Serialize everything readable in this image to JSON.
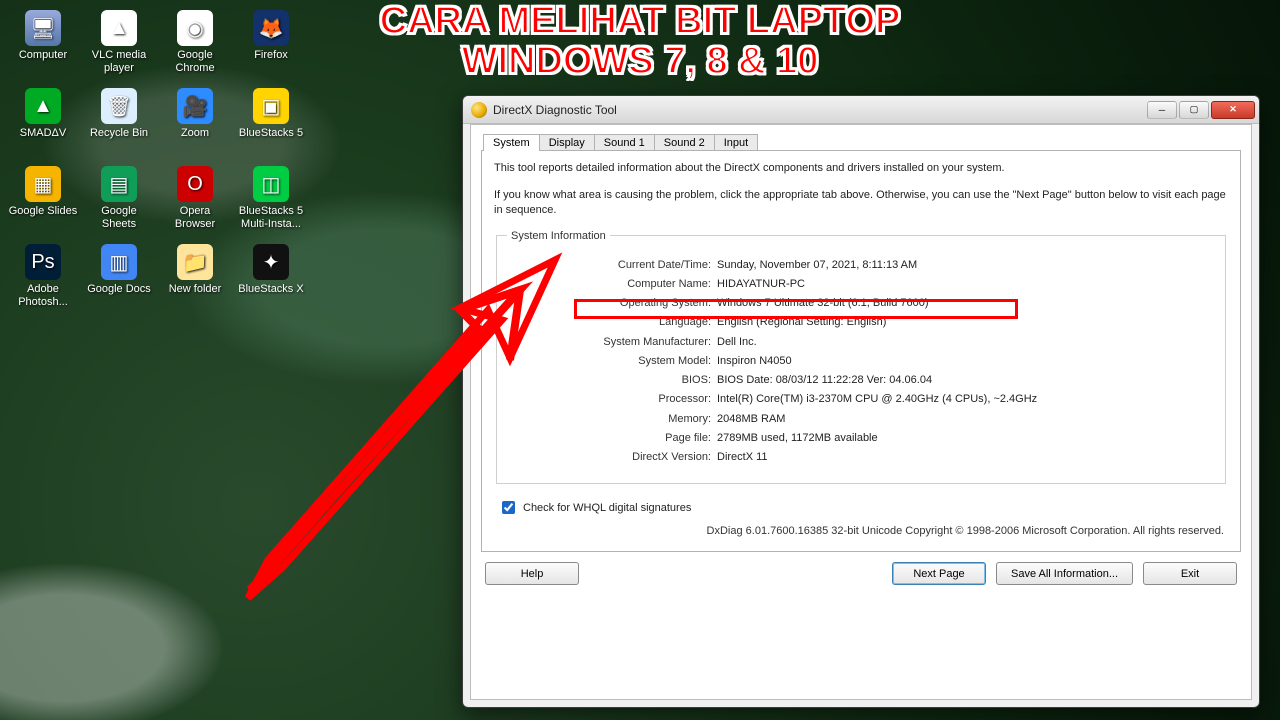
{
  "overlay": {
    "line1": "CARA MELIHAT BIT LAPTOP",
    "line2": "WINDOWS 7, 8 & 10"
  },
  "desktop_icons": [
    {
      "label": "Computer",
      "glyph": "🖥",
      "g": "g-computer"
    },
    {
      "label": "VLC media\nplayer",
      "glyph": "▲",
      "g": "g-vlc"
    },
    {
      "label": "Google\nChrome",
      "glyph": "◉",
      "g": "g-chrome"
    },
    {
      "label": "Firefox",
      "glyph": "🦊",
      "g": "g-firefox"
    },
    {
      "label": "SMADΔV",
      "glyph": "▲",
      "g": "g-smadav"
    },
    {
      "label": "Recycle Bin",
      "glyph": "🗑",
      "g": "g-recycle"
    },
    {
      "label": "Zoom",
      "glyph": "🎥",
      "g": "g-zoom"
    },
    {
      "label": "BlueStacks 5",
      "glyph": "▣",
      "g": "g-bs"
    },
    {
      "label": "Google Slides",
      "glyph": "▦",
      "g": "g-slides"
    },
    {
      "label": "Google\nSheets",
      "glyph": "▤",
      "g": "g-sheets"
    },
    {
      "label": "Opera\nBrowser",
      "glyph": "O",
      "g": "g-opera"
    },
    {
      "label": "BlueStacks 5\nMulti-Insta...",
      "glyph": "◫",
      "g": "g-bs5"
    },
    {
      "label": "Adobe\nPhotosh...",
      "glyph": "Ps",
      "g": "g-ps"
    },
    {
      "label": "Google Docs",
      "glyph": "▥",
      "g": "g-docs"
    },
    {
      "label": "New folder",
      "glyph": "📁",
      "g": "g-folder"
    },
    {
      "label": "BlueStacks X",
      "glyph": "✦",
      "g": "g-bsx"
    }
  ],
  "window": {
    "title": "DirectX Diagnostic Tool",
    "tabs": [
      "System",
      "Display",
      "Sound 1",
      "Sound 2",
      "Input"
    ],
    "active_tab": "System",
    "intro1": "This tool reports detailed information about the DirectX components and drivers installed on your system.",
    "intro2": "If you know what area is causing the problem, click the appropriate tab above.  Otherwise, you can use the \"Next Page\" button below to visit each page in sequence.",
    "sysinfo_title": "System Information",
    "rows": [
      {
        "k": "Current Date/Time:",
        "v": "Sunday, November 07, 2021, 8:11:13 AM"
      },
      {
        "k": "Computer Name:",
        "v": "HIDAYATNUR-PC"
      },
      {
        "k": "Operating System:",
        "v": "Windows 7 Ultimate 32-bit (6.1, Build 7600)"
      },
      {
        "k": "Language:",
        "v": "English (Regional Setting: English)"
      },
      {
        "k": "System Manufacturer:",
        "v": "Dell Inc."
      },
      {
        "k": "System Model:",
        "v": "Inspiron N4050"
      },
      {
        "k": "BIOS:",
        "v": "BIOS Date: 08/03/12 11:22:28 Ver: 04.06.04"
      },
      {
        "k": "Processor:",
        "v": "Intel(R) Core(TM) i3-2370M CPU @ 2.40GHz (4 CPUs), ~2.4GHz"
      },
      {
        "k": "Memory:",
        "v": "2048MB RAM"
      },
      {
        "k": "Page file:",
        "v": "2789MB used, 1172MB available"
      },
      {
        "k": "DirectX Version:",
        "v": "DirectX 11"
      }
    ],
    "whql_label": "Check for WHQL digital signatures",
    "whql_checked": true,
    "copyright": "DxDiag 6.01.7600.16385 32-bit Unicode  Copyright © 1998-2006 Microsoft Corporation.  All rights reserved.",
    "buttons": {
      "help": "Help",
      "next": "Next Page",
      "save": "Save All Information...",
      "exit": "Exit"
    }
  }
}
